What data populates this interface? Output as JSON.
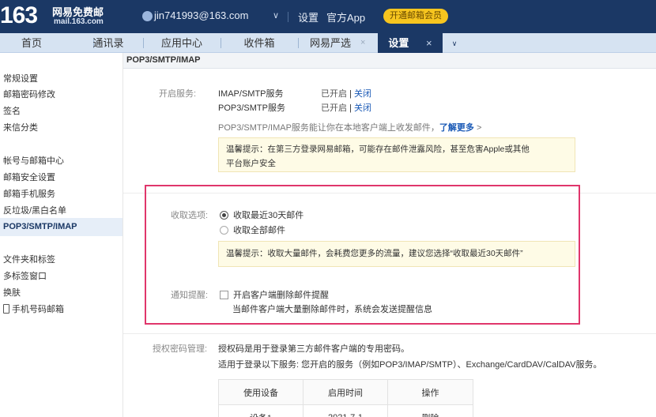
{
  "header": {
    "logo_number": "163",
    "logo_cn": "网易免费邮",
    "logo_en": "mail.163.com",
    "user_email": "jin741993@163.com",
    "user_menu_icon": "chevron-down-icon",
    "settings_link": "设置",
    "app_link": "官方App",
    "vip_button": "开通邮箱会员",
    "colors": {
      "bar": "#1b3865",
      "vip": "#f7c51f"
    }
  },
  "tabs": [
    {
      "label": "首页"
    },
    {
      "label": "通讯录"
    },
    {
      "label": "应用中心"
    },
    {
      "label": "收件箱"
    },
    {
      "label": "网易严选",
      "close": "×"
    },
    {
      "label": "设置",
      "close": "×",
      "active": true
    }
  ],
  "sidebar": {
    "items": [
      {
        "label": "常规设置"
      },
      {
        "label": "邮箱密码修改"
      },
      {
        "label": "签名"
      },
      {
        "label": "来信分类"
      },
      {
        "label": "帐号与邮箱中心"
      },
      {
        "label": "邮箱安全设置"
      },
      {
        "label": "邮箱手机服务"
      },
      {
        "label": "反垃圾/黑白名单"
      },
      {
        "label": "POP3/SMTP/IMAP",
        "active": true
      },
      {
        "label": "文件夹和标签"
      },
      {
        "label": "多标签窗口"
      },
      {
        "label": "换肤"
      },
      {
        "label": "手机号码邮箱",
        "icon": "phone-icon"
      }
    ]
  },
  "main": {
    "section_title": "POP3/SMTP/IMAP",
    "enable": {
      "label": "开启服务:",
      "services": [
        {
          "name": "IMAP/SMTP服务",
          "status": "已开启",
          "sep": "|",
          "action": "关闭"
        },
        {
          "name": "POP3/SMTP服务",
          "status": "已开启",
          "sep": "|",
          "action": "关闭"
        }
      ],
      "desc": "POP3/SMTP/IMAP服务能让你在本地客户端上收发邮件，",
      "learn_more": "了解更多",
      "learn_more_arrow": ">",
      "notice_line1": "温馨提示：在第三方登录网易邮箱，可能存在邮件泄露风险，甚至危害Apple或其他",
      "notice_line2": "平台账户安全"
    },
    "receive": {
      "label": "收取选项:",
      "options": [
        {
          "label": "收取最近30天邮件",
          "selected": true
        },
        {
          "label": "收取全部邮件",
          "selected": false
        }
      ],
      "notice": "温馨提示：收取大量邮件，会耗费您更多的流量，建议您选择“收取最近30天邮件”"
    },
    "notify": {
      "label": "通知提醒:",
      "checkbox_label": "开启客户端删除邮件提醒",
      "checked": false,
      "desc": "当邮件客户端大量删除邮件时，系统会发送提醒信息"
    },
    "auth": {
      "label": "授权密码管理:",
      "line1": "授权码是用于登录第三方邮件客户端的专用密码。",
      "line2": "适用于登录以下服务: 您开启的服务（例如POP3/IMAP/SMTP）、Exchange/CardDAV/CalDAV服务。",
      "table_headers": [
        "使用设备",
        "启用时间",
        "操作"
      ],
      "rows": [
        {
          "device": "设备1",
          "time": "2021-7-1",
          "action": "删除"
        }
      ]
    },
    "highlight_color": "#e0366b"
  }
}
